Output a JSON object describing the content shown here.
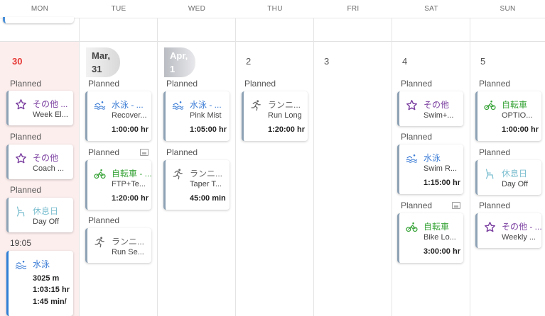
{
  "weekdays": [
    "MON",
    "TUE",
    "WED",
    "THU",
    "FRI",
    "SAT",
    "SUN"
  ],
  "days": {
    "mon": {
      "date": "30",
      "labels": [
        "Planned",
        "Planned",
        "Planned",
        "19:05"
      ],
      "cards": [
        {
          "icon": "star-icon",
          "title": "その他 ...",
          "subtitle": "Week El..."
        },
        {
          "icon": "star-icon",
          "title": "その他",
          "subtitle": "Coach ..."
        },
        {
          "icon": "rest-chair-icon",
          "title": "休息日",
          "subtitle": "Day Off"
        },
        {
          "icon": "swim-icon",
          "title": "水泳",
          "metrics": [
            "3025 m",
            "1:03:15 hr",
            "1:45 min/"
          ]
        }
      ]
    },
    "tue": {
      "date_line1": "Mar,",
      "date_line2": "31",
      "labels": [
        "Planned",
        "Planned",
        "Planned"
      ],
      "cards": [
        {
          "icon": "swim-icon",
          "title": "水泳 - ...",
          "subtitle": "Recover...",
          "metric": "1:00:00 hr"
        },
        {
          "icon": "bike-icon",
          "title": "自転車 - ...",
          "subtitle": "FTP+Te...",
          "metric": "1:20:00 hr"
        },
        {
          "icon": "run-icon",
          "title": "ランニ...",
          "subtitle": "Run Se..."
        }
      ]
    },
    "wed": {
      "date_line1": "Apr,",
      "date_line2": "1",
      "labels": [
        "Planned",
        "Planned"
      ],
      "cards": [
        {
          "icon": "swim-icon",
          "title": "水泳 - ...",
          "subtitle": "Pink Mist",
          "metric": "1:05:00 hr"
        },
        {
          "icon": "run-icon",
          "title": "ランニ...",
          "subtitle": "Taper T...",
          "metric": "45:00 min"
        }
      ]
    },
    "thu": {
      "date": "2",
      "labels": [
        "Planned"
      ],
      "cards": [
        {
          "icon": "run-icon",
          "title": "ランニ...",
          "subtitle": "Run Long",
          "metric": "1:20:00 hr"
        }
      ]
    },
    "fri": {
      "date": "3"
    },
    "sat": {
      "date": "4",
      "labels": [
        "Planned",
        "Planned",
        "Planned"
      ],
      "cards": [
        {
          "icon": "star-icon",
          "title": "その他",
          "subtitle": "Swim+..."
        },
        {
          "icon": "swim-icon",
          "title": "水泳",
          "subtitle": "Swim R...",
          "metric": "1:15:00 hr"
        },
        {
          "icon": "bike-icon",
          "title": "自転車",
          "subtitle": "Bike Lo...",
          "metric": "3:00:00 hr"
        }
      ]
    },
    "sun": {
      "date": "5",
      "labels": [
        "Planned",
        "Planned",
        "Planned"
      ],
      "cards": [
        {
          "icon": "bike-icon",
          "title": "自転車",
          "subtitle": "OPTIO...",
          "metric": "1:00:00 hr"
        },
        {
          "icon": "rest-chair-icon",
          "title": "休息日",
          "subtitle": "Day Off"
        },
        {
          "icon": "star-icon",
          "title": "その他 - ...",
          "subtitle": "Weekly ..."
        }
      ]
    }
  },
  "colors": {
    "today_bg": "#fdeeee",
    "today_text": "#e53935",
    "other": "#7b3fa0",
    "swim": "#3a7bd5",
    "bike": "#3ba53b",
    "run": "#666666",
    "rest": "#7dbfd0"
  }
}
